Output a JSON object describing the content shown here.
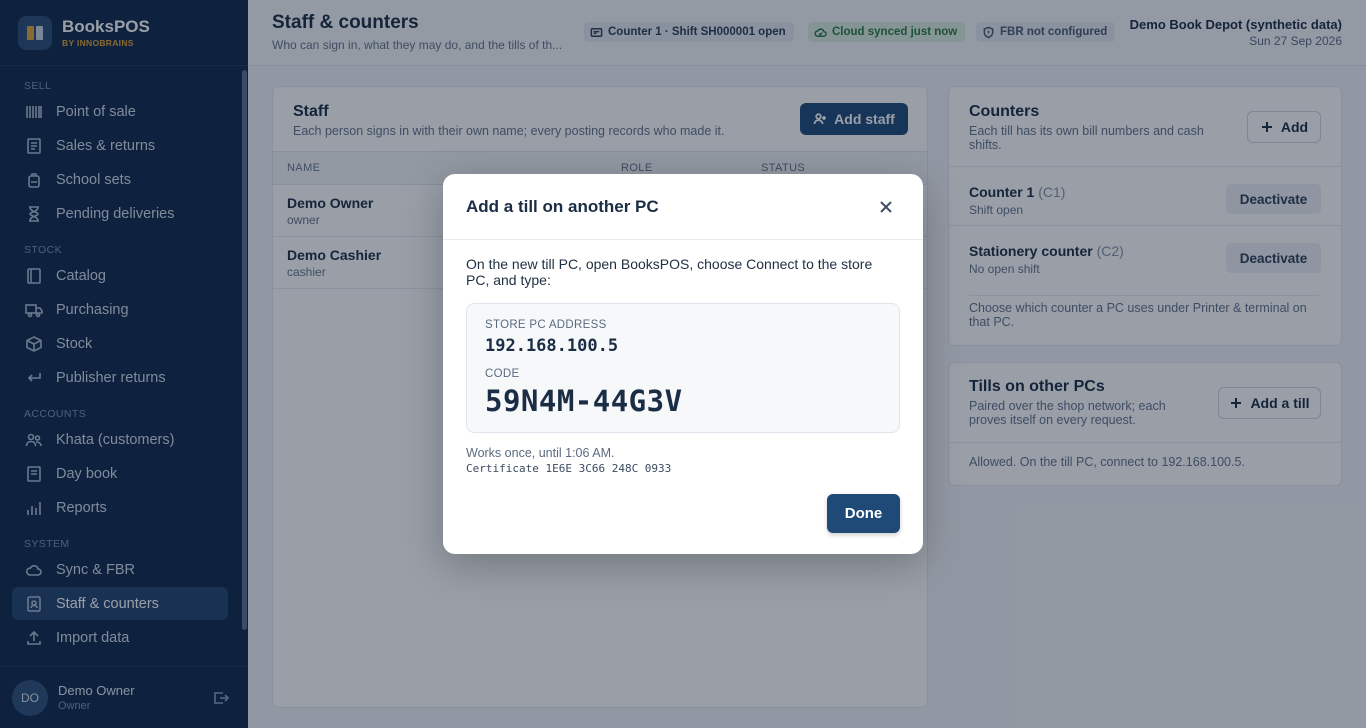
{
  "brand": {
    "name": "BooksPOS",
    "sub": "BY INNOBRAINS"
  },
  "sidebar": {
    "sections": [
      {
        "label": "SELL",
        "items": [
          {
            "label": "Point of sale",
            "icon": "barcode-icon"
          },
          {
            "label": "Sales & returns",
            "icon": "receipt-icon"
          },
          {
            "label": "School sets",
            "icon": "backpack-icon"
          },
          {
            "label": "Pending deliveries",
            "icon": "hourglass-icon"
          }
        ]
      },
      {
        "label": "STOCK",
        "items": [
          {
            "label": "Catalog",
            "icon": "book-icon"
          },
          {
            "label": "Purchasing",
            "icon": "truck-icon"
          },
          {
            "label": "Stock",
            "icon": "box-icon"
          },
          {
            "label": "Publisher returns",
            "icon": "return-arrow-icon"
          }
        ]
      },
      {
        "label": "ACCOUNTS",
        "items": [
          {
            "label": "Khata (customers)",
            "icon": "users-icon"
          },
          {
            "label": "Day book",
            "icon": "ledger-icon"
          },
          {
            "label": "Reports",
            "icon": "bar-chart-icon"
          }
        ]
      },
      {
        "label": "SYSTEM",
        "items": [
          {
            "label": "Sync & FBR",
            "icon": "cloud-icon"
          },
          {
            "label": "Staff & counters",
            "icon": "id-badge-icon",
            "active": true
          },
          {
            "label": "Import data",
            "icon": "upload-icon"
          }
        ]
      }
    ],
    "user": {
      "initials": "DO",
      "name": "Demo Owner",
      "role": "Owner"
    }
  },
  "header": {
    "title": "Staff & counters",
    "subtitle": "Who can sign in, what they may do, and the tills of th...",
    "chips": {
      "counter": "Counter 1 · Shift SH000001 open",
      "sync": "Cloud synced just now",
      "fbr": "FBR not configured"
    },
    "store_name": "Demo Book Depot (synthetic data)",
    "date": "Sun 27 Sep 2026"
  },
  "staff": {
    "title": "Staff",
    "description": "Each person signs in with their own name; every posting records who made it.",
    "add_label": "Add staff",
    "columns": {
      "name": "NAME",
      "role": "ROLE",
      "status": "STATUS"
    },
    "rows": [
      {
        "name": "Demo Owner",
        "role": "owner"
      },
      {
        "name": "Demo Cashier",
        "role": "cashier"
      }
    ]
  },
  "counters": {
    "title": "Counters",
    "description": "Each till has its own bill numbers and cash shifts.",
    "add_label": "Add",
    "items": [
      {
        "name": "Counter 1",
        "code": "(C1)",
        "status": "Shift open",
        "action": "Deactivate"
      },
      {
        "name": "Stationery counter",
        "code": "(C2)",
        "status": "No open shift",
        "action": "Deactivate"
      }
    ],
    "footer": "Choose which counter a PC uses under Printer & terminal on that PC."
  },
  "tills": {
    "title": "Tills on other PCs",
    "description": "Paired over the shop network; each proves itself on every request.",
    "add_label": "Add a till",
    "footer": "Allowed. On the till PC, connect to 192.168.100.5."
  },
  "modal": {
    "title": "Add a till on another PC",
    "intro": "On the new till PC, open BooksPOS, choose Connect to the store PC, and type:",
    "address_label": "STORE PC ADDRESS",
    "address": "192.168.100.5",
    "code_label": "CODE",
    "code": "59N4M-44G3V",
    "expiry": "Works once, until 1:06 AM.",
    "certificate": "Certificate 1E6E 3C66 248C 0933",
    "done_label": "Done"
  },
  "colors": {
    "sidebar_bg": "#11294a",
    "primary": "#1f4a78",
    "brand_accent": "#e0a63a",
    "sync_green": "#2d7a44"
  }
}
